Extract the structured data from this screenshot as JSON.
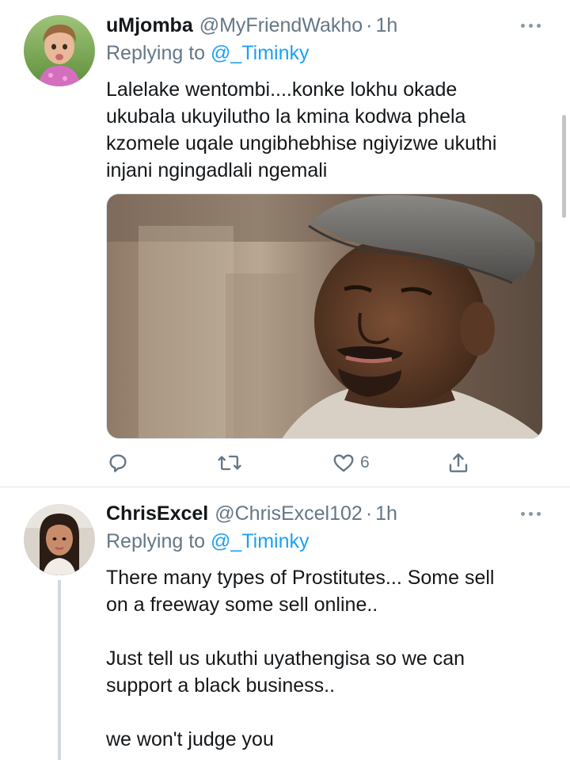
{
  "tweets": [
    {
      "display_name": "uMjomba",
      "handle": "@MyFriendWakho",
      "separator": "·",
      "time": "1h",
      "replying_label": "Replying to",
      "replying_to": "@_Timinky",
      "body_lines": [
        "Lalelake wentombi....konke lokhu okade",
        "ukubala ukuyilutho la kmina kodwa phela",
        "kzomele uqale ungibhebhise ngiyizwe ukuthi",
        "injani ngingadlali ngemali"
      ],
      "has_media": true,
      "actions": {
        "reply_icon": "reply-icon",
        "retweet_icon": "retweet-icon",
        "like_icon": "heart-icon",
        "like_count": "6",
        "share_icon": "share-icon"
      }
    },
    {
      "display_name": "ChrisExcel",
      "handle": "@ChrisExcel102",
      "separator": "·",
      "time": "1h",
      "replying_label": "Replying to",
      "replying_to": "@_Timinky",
      "body_lines": [
        "There many types of Prostitutes... Some sell",
        "on a freeway some sell online..",
        "",
        "Just tell us ukuthi uyathengisa so we can",
        "support a black business..",
        "",
        "we won't judge you"
      ]
    }
  ],
  "colors": {
    "link": "#1da1f2",
    "secondary_text": "#657786",
    "primary_text": "#14171a",
    "divider": "#e1e8ed"
  }
}
